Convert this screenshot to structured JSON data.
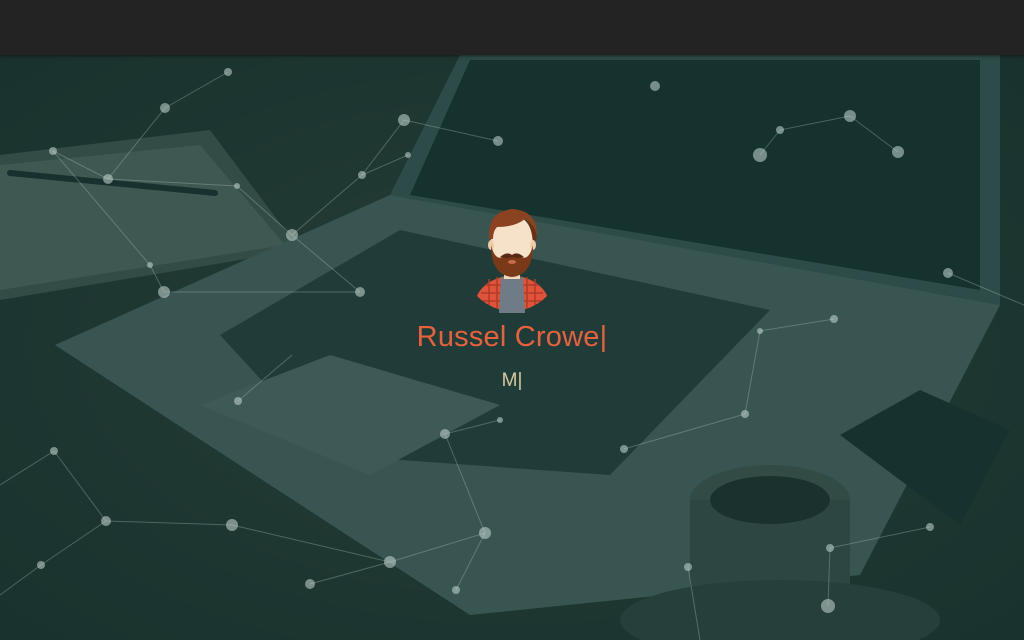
{
  "profile": {
    "name": "Russel Crowe",
    "subtitle": "M",
    "cursor": "|"
  },
  "colors": {
    "topbar": "#232323",
    "overlay": "#103a36",
    "name": "#e8603c",
    "subtitle": "#d8c8a0",
    "particle": "#c8d8d4"
  },
  "icons": {
    "avatar": "bearded-man-avatar"
  }
}
